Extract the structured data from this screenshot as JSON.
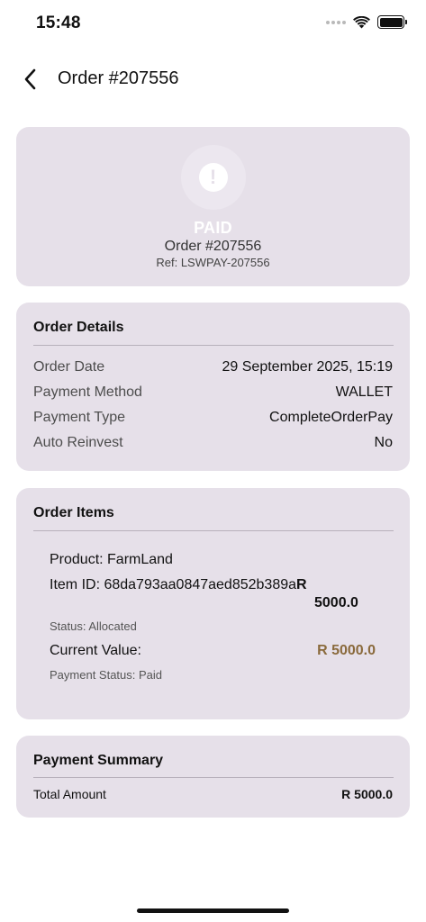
{
  "status_bar": {
    "time": "15:48"
  },
  "nav": {
    "title": "Order #207556"
  },
  "hero": {
    "status": "PAID",
    "order": "Order #207556",
    "ref": "Ref: LSWPAY-207556",
    "icon": "alert-icon"
  },
  "order_details": {
    "title": "Order Details",
    "rows": [
      {
        "label": "Order Date",
        "value": "29 September 2025, 15:19"
      },
      {
        "label": "Payment Method",
        "value": "WALLET"
      },
      {
        "label": "Payment Type",
        "value": "CompleteOrderPay"
      },
      {
        "label": "Auto Reinvest",
        "value": "No"
      }
    ]
  },
  "order_items": {
    "title": "Order Items",
    "product": "Product: FarmLand",
    "item_id": "Item ID: 68da793aa0847aed852b389a",
    "item_amount_r": "R",
    "item_amount": "5000.0",
    "status": "Status: Allocated",
    "current_value_label": "Current Value:",
    "current_value": "R 5000.0",
    "payment_status": "Payment Status: Paid"
  },
  "payment_summary": {
    "title": "Payment Summary",
    "total_label": "Total Amount",
    "total_value": "R 5000.0"
  },
  "colors": {
    "card_bg": "#e6e0e9",
    "accent_value": "#8a6a3c"
  }
}
